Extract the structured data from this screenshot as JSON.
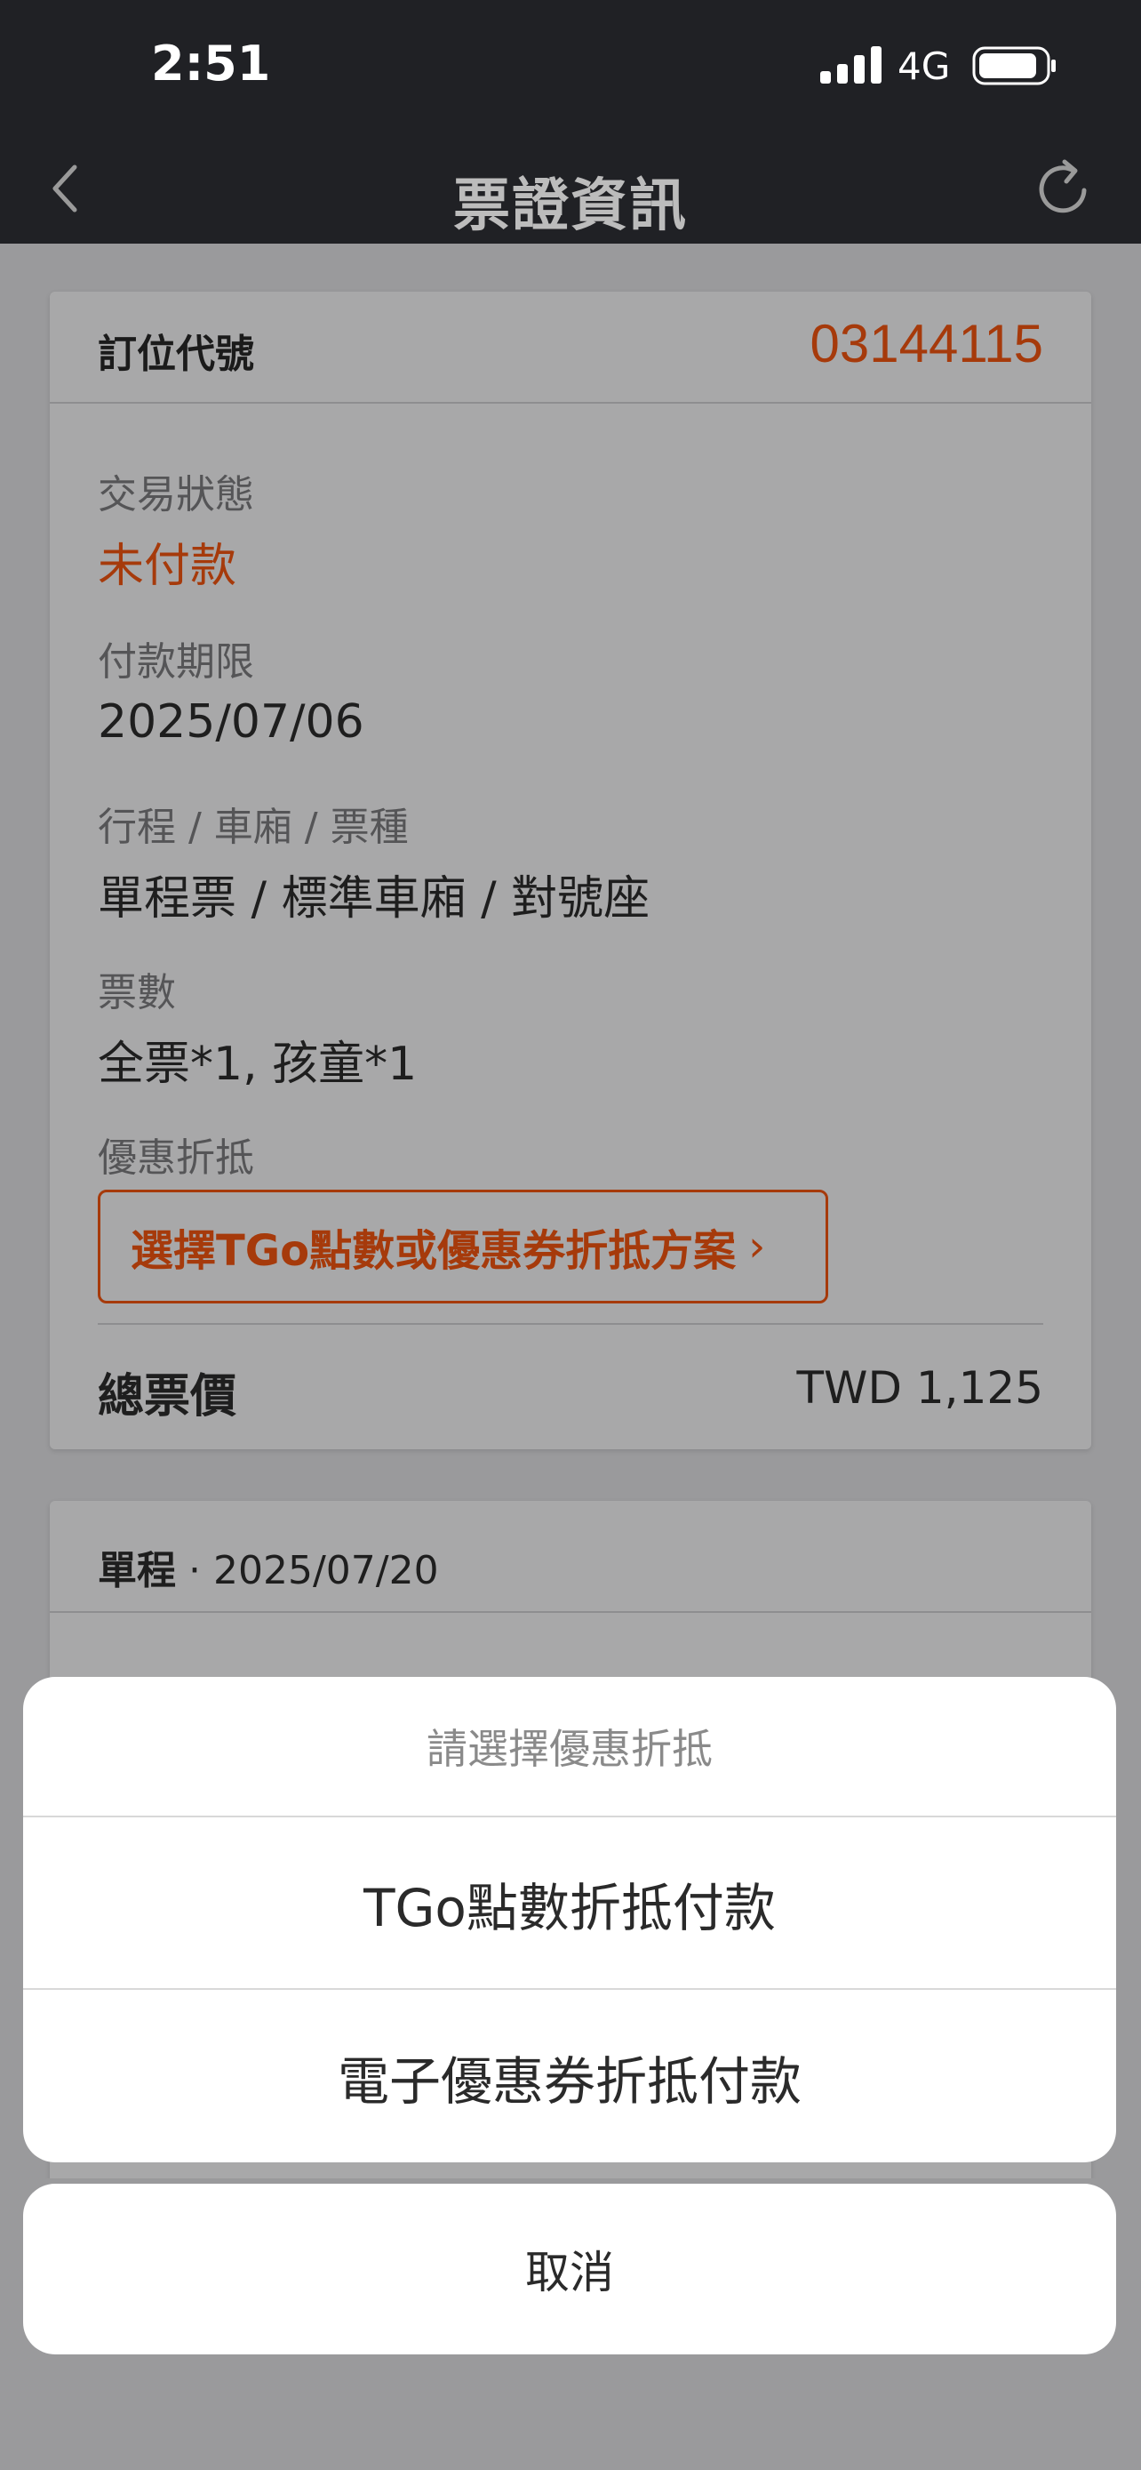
{
  "status_bar": {
    "time": "2:51",
    "network": "4G",
    "icons": [
      "signal-icon",
      "battery-icon"
    ]
  },
  "nav": {
    "title": "票證資訊",
    "back_icon": "chevron-left-icon",
    "refresh_icon": "refresh-icon"
  },
  "booking": {
    "code_label": "訂位代號",
    "code_value": "03144115",
    "status_label": "交易狀態",
    "status_value": "未付款",
    "deadline_label": "付款期限",
    "deadline_value": "2025/07/06",
    "trip_label": "行程 / 車廂 / 票種",
    "trip_value": "單程票 / 標準車廂 / 對號座",
    "tickets_label": "票數",
    "tickets_value": "全票*1, 孩童*1",
    "discount_label": "優惠折抵",
    "discount_button": "選擇TGo點數或優惠券折抵方案",
    "discount_chevron": "›",
    "total_label": "總票價",
    "total_value": "TWD 1,125"
  },
  "journey": {
    "label": "單程",
    "separator": "·",
    "date": "2025/07/20"
  },
  "action_sheet": {
    "title": "請選擇優惠折抵",
    "options": [
      "TGo點數折抵付款",
      "電子優惠券折抵付款"
    ],
    "cancel": "取消"
  },
  "colors": {
    "accent": "#a63a0b",
    "nav_bg": "#202125",
    "overlay": "#9a9a9c"
  }
}
